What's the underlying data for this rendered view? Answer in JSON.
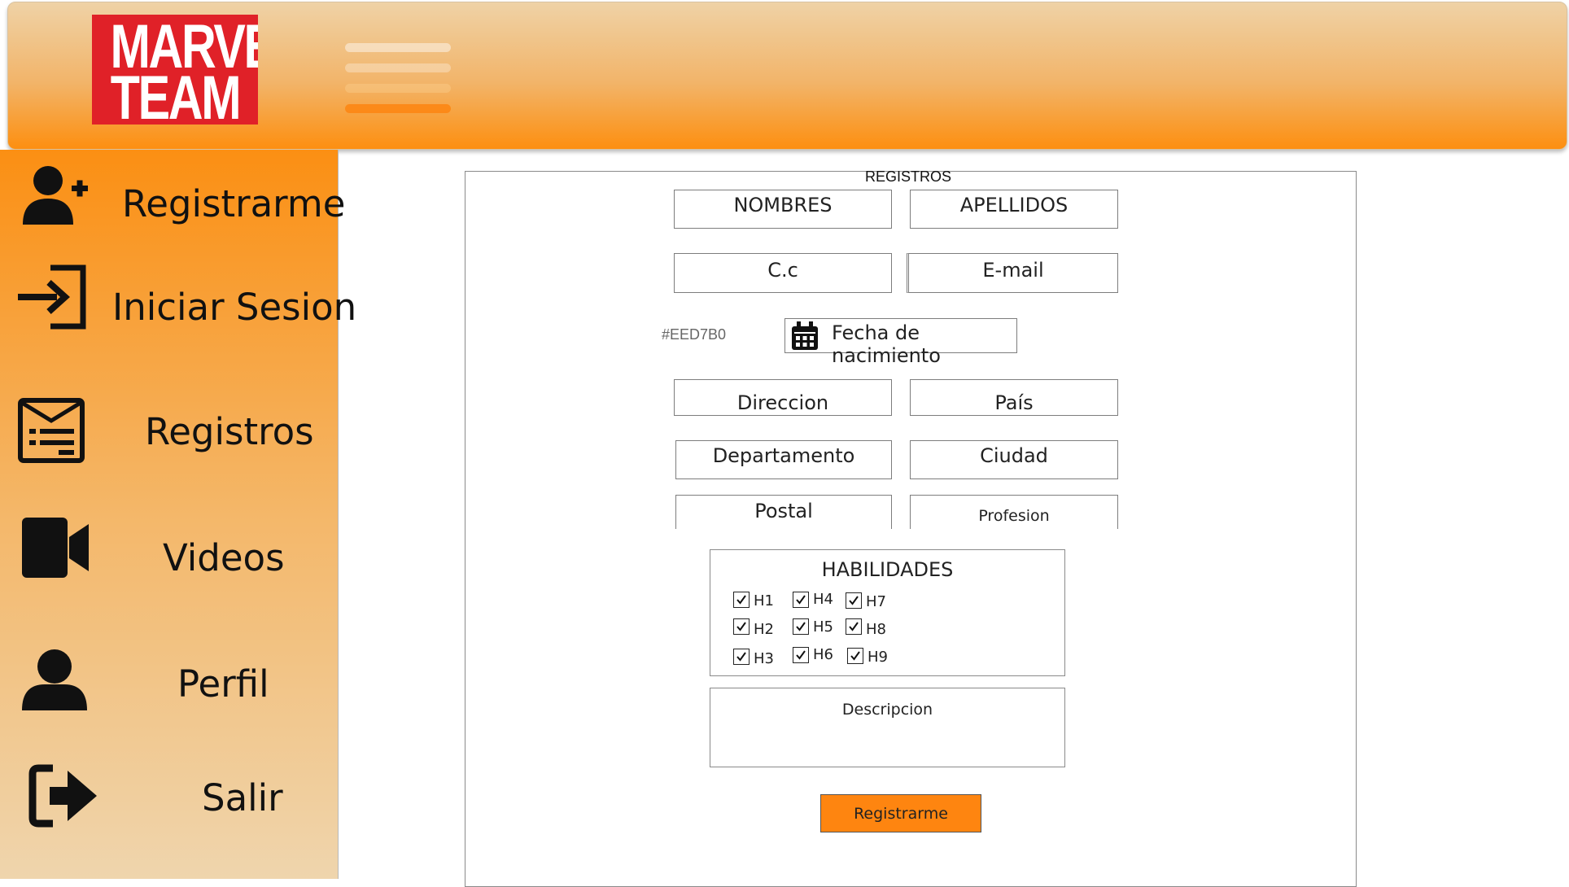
{
  "app": {
    "logo_line1": "MARVEL",
    "logo_line2": "TEAM",
    "colors": {
      "accent": "#fe8510",
      "logo_red": "#e02128",
      "header_light": "#efd2a6",
      "header_dark": "#fd8f10"
    }
  },
  "sidebar": {
    "items": [
      {
        "label": "Registrarme",
        "icon": "user-plus-icon"
      },
      {
        "label": "Iniciar Sesion",
        "icon": "sign-in-icon"
      },
      {
        "label": "Registros",
        "icon": "newspaper-icon"
      },
      {
        "label": "Videos",
        "icon": "video-camera-icon"
      },
      {
        "label": "Perfil",
        "icon": "user-icon"
      },
      {
        "label": "Salir",
        "icon": "sign-out-icon"
      }
    ]
  },
  "form": {
    "title": "REGISTROS",
    "nombres": "NOMBRES",
    "apellidos": "APELLIDOS",
    "cc": "C.c",
    "email": "E-mail",
    "color_label": "#EED7B0",
    "fecha": "Fecha de nacimiento",
    "direccion": "Direccion",
    "pais": "País",
    "departamento": "Departamento",
    "ciudad": "Ciudad",
    "postal": "Postal",
    "profesion": "Profesion",
    "skills_title": "HABILIDADES",
    "skills": [
      "H1",
      "H2",
      "H3",
      "H4",
      "H5",
      "H6",
      "H7",
      "H8",
      "H9"
    ],
    "descripcion": "Descripcion",
    "submit": "Registrarme"
  }
}
